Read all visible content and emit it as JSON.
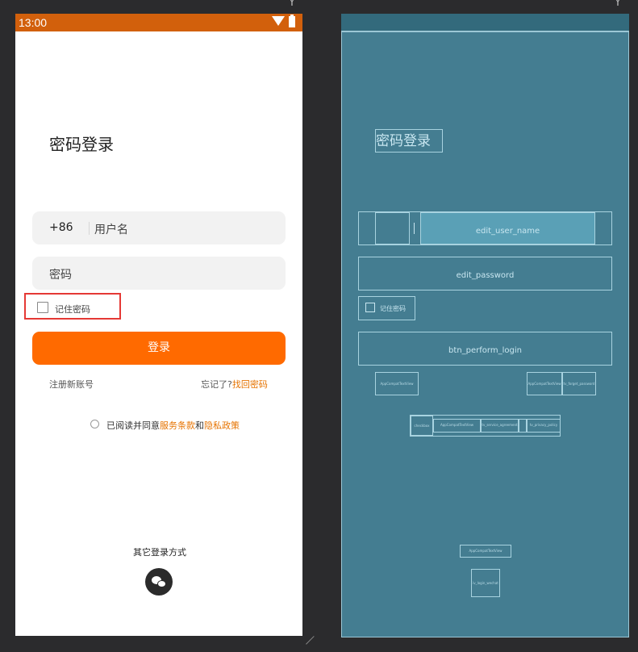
{
  "status_bar": {
    "time": "13:00"
  },
  "login": {
    "title": "密码登录",
    "country_code": "+86",
    "username_hint": "用户名",
    "password_hint": "密码",
    "remember_label": "记住密码",
    "login_button": "登录",
    "register_link": "注册新账号",
    "forgot_prefix": "忘记了?",
    "forgot_link": "找回密码",
    "agreement_prefix": "已阅读并同意",
    "terms_link": "服务条款",
    "agreement_and": "和",
    "privacy_link": "隐私政策",
    "other_methods": "其它登录方式"
  },
  "blueprint": {
    "title": "密码登录",
    "edit_user_name": "edit_user_name",
    "edit_password": "edit_password",
    "remember_label": "记住密码",
    "btn_perform_login": "btn_perform_login",
    "tiny_register": "AppCompatTextView",
    "tiny_forgot_a": "AppCompatTextView",
    "tiny_forgot_b": "tv_forget_password",
    "tiny_agree_a": "checkbox",
    "tiny_agree_b": "AppCompatTextView",
    "tiny_agree_c": "tv_service_agreement",
    "tiny_agree_d": "tv_privacy_policy",
    "tiny_other": "AppCompatTextView",
    "tiny_wechat": "iv_login_wechat"
  },
  "icons": [
    "wifi-icon",
    "battery-icon",
    "wechat-icon",
    "checkbox-icon",
    "radio-icon"
  ],
  "colors": {
    "status_bar": "#d2600c",
    "accent": "#ff6a00",
    "link": "#e67300",
    "blueprint": "#447d91"
  }
}
